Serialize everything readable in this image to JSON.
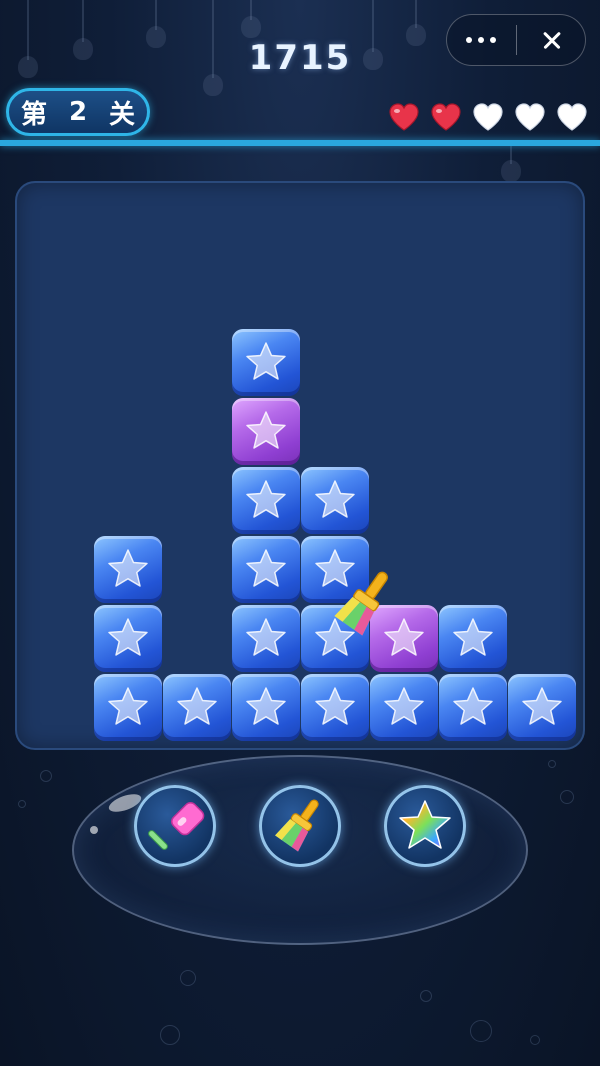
{
  "header": {
    "score": "1715",
    "level": {
      "prefix": "第",
      "number": "2",
      "suffix": "关"
    },
    "lives": {
      "total": 5,
      "filled": 2
    }
  },
  "capsule": {
    "more_icon": "more-dots-icon",
    "close_icon": "close-icon"
  },
  "board": {
    "columns": 7,
    "rows": 6,
    "tiles": [
      {
        "col": 2,
        "row": 0,
        "color": "blue"
      },
      {
        "col": 2,
        "row": 1,
        "color": "purple"
      },
      {
        "col": 2,
        "row": 2,
        "color": "blue"
      },
      {
        "col": 3,
        "row": 2,
        "color": "blue"
      },
      {
        "col": 0,
        "row": 3,
        "color": "blue"
      },
      {
        "col": 2,
        "row": 3,
        "color": "blue"
      },
      {
        "col": 3,
        "row": 3,
        "color": "blue"
      },
      {
        "col": 0,
        "row": 4,
        "color": "blue"
      },
      {
        "col": 2,
        "row": 4,
        "color": "blue"
      },
      {
        "col": 3,
        "row": 4,
        "color": "blue"
      },
      {
        "col": 4,
        "row": 4,
        "color": "purple"
      },
      {
        "col": 5,
        "row": 4,
        "color": "blue"
      },
      {
        "col": 0,
        "row": 5,
        "color": "blue"
      },
      {
        "col": 1,
        "row": 5,
        "color": "blue"
      },
      {
        "col": 2,
        "row": 5,
        "color": "blue"
      },
      {
        "col": 3,
        "row": 5,
        "color": "blue"
      },
      {
        "col": 4,
        "row": 5,
        "color": "blue"
      },
      {
        "col": 5,
        "row": 5,
        "color": "blue"
      },
      {
        "col": 6,
        "row": 5,
        "color": "blue"
      }
    ]
  },
  "tools": [
    {
      "name": "hammer",
      "icon": "hammer-icon"
    },
    {
      "name": "brush",
      "icon": "paintbrush-icon"
    },
    {
      "name": "rainbow-star",
      "icon": "rainbow-star-icon"
    }
  ],
  "colors": {
    "accent": "#2aa7de",
    "tile_blue": "#2f66e0",
    "tile_purple": "#9b4fd9",
    "heart_full": "#e8344a",
    "heart_empty": "#ffffff"
  }
}
